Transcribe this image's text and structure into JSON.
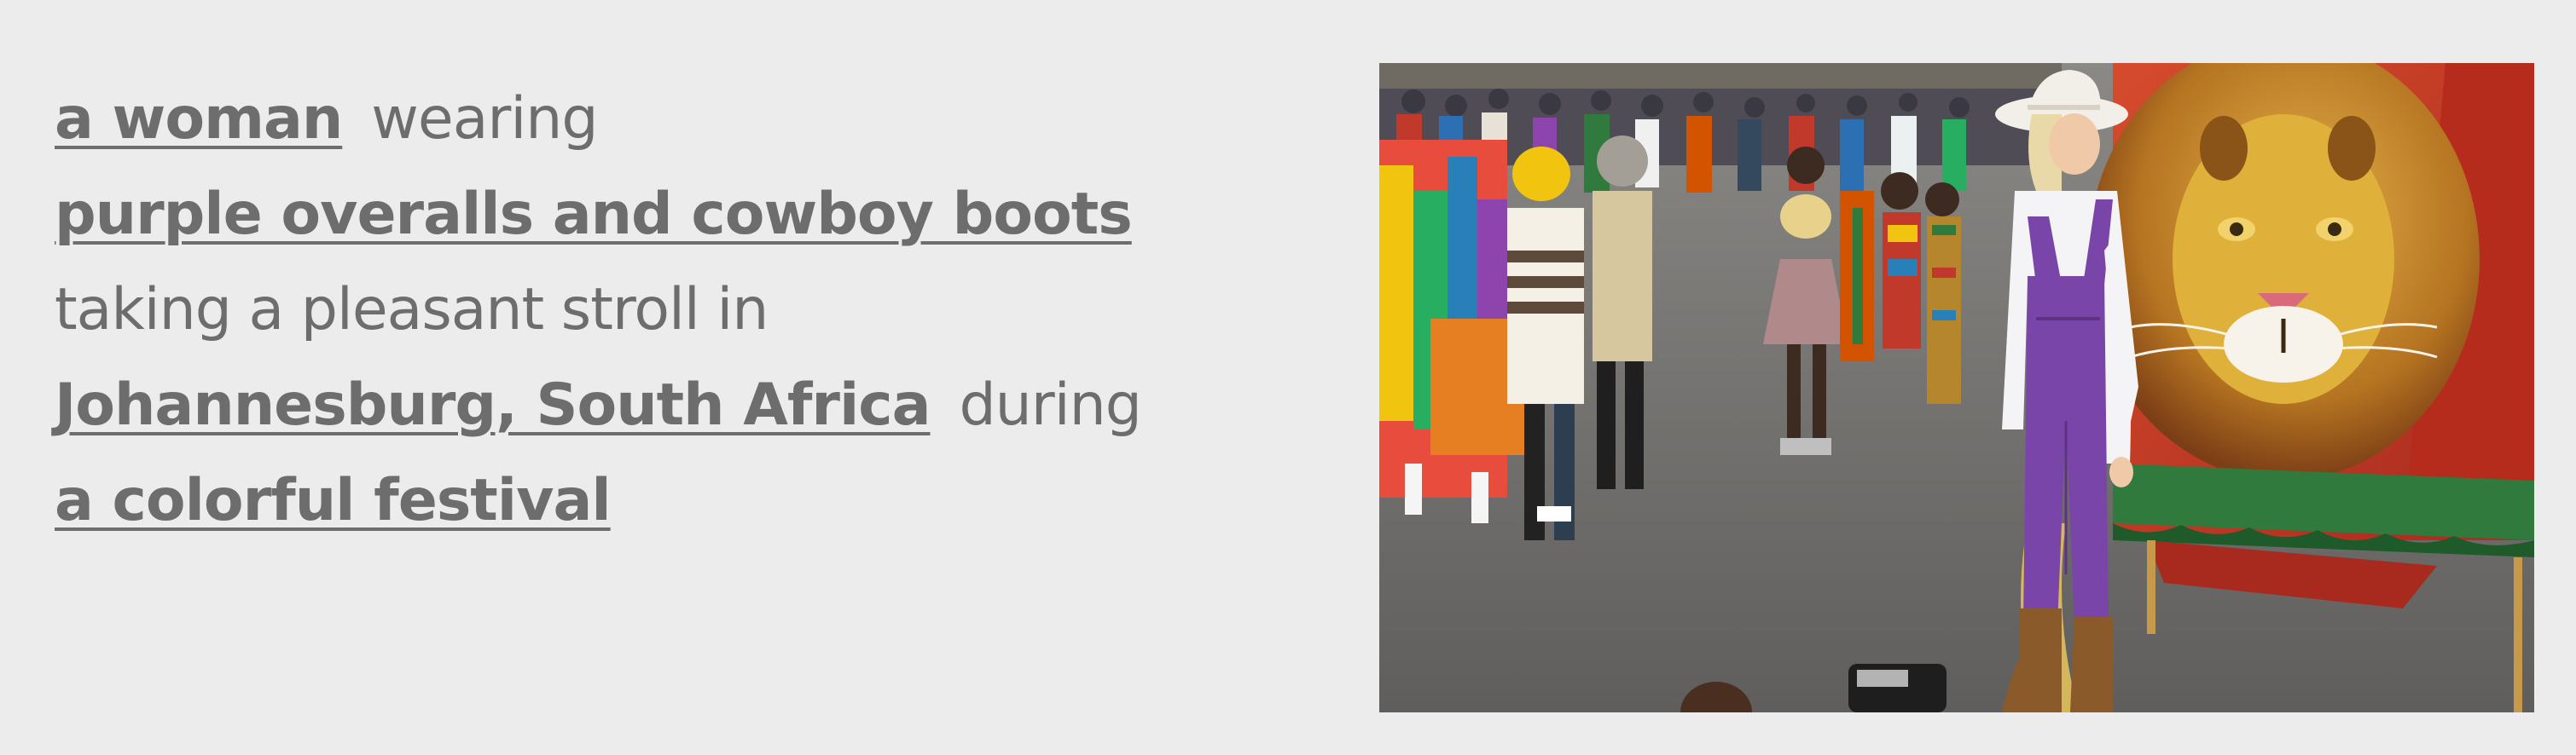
{
  "caption": {
    "line1": {
      "subject": "a woman",
      "verb": "wearing"
    },
    "line2": {
      "attire": "purple overalls and cowboy boots"
    },
    "line3": {
      "action": "taking a pleasant stroll in"
    },
    "line4": {
      "location": "Johannesburg, South Africa",
      "connector": "during"
    },
    "line5": {
      "event": "a colorful festival"
    }
  },
  "photo": {
    "colors": {
      "road": "#6e6d6b",
      "crowd": "#4c4a52",
      "overalls": "#7a45a8",
      "shirt": "#f4f4f6",
      "hat": "#f2efe9",
      "boots": "#8a5a2b",
      "lion_mane": "#c8872a",
      "lion_face": "#e0b13a",
      "mural_red": "#c33a24",
      "banner_green": "#2f7a3c",
      "road_line": "#e1c15a"
    }
  }
}
